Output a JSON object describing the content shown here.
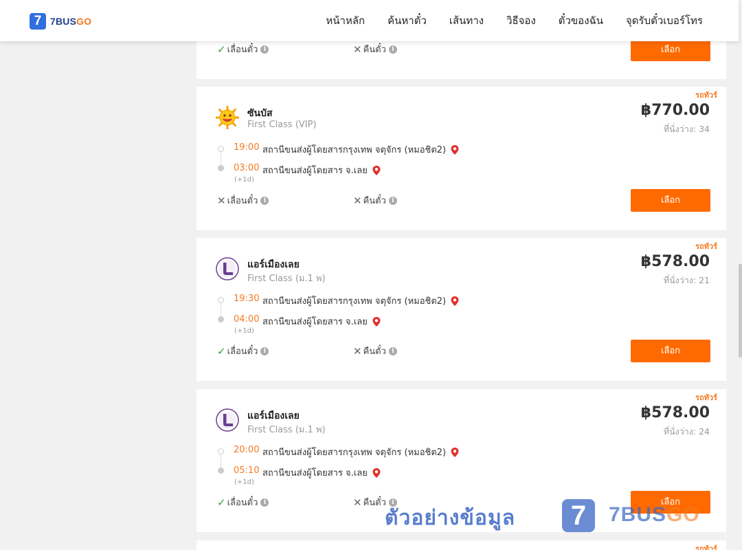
{
  "header": {
    "logo_mark": "7",
    "logo_brand": "7BUS",
    "logo_brand_accent": "GO",
    "nav": [
      "หน้าหลัก",
      "ค้นหาตั๋ว",
      "เส้นทาง",
      "วิธีจอง",
      "ตั๋วของฉัน",
      "จุดรับตั๋วเบอร์โทร"
    ]
  },
  "labels": {
    "reschedule": "เลื่อนตั๋ว",
    "refund": "คืนตั๋ว",
    "select": "เลือก",
    "tag": "รถทัวร์",
    "seats_prefix": "ที่นั่งว่าง: ",
    "info": "i",
    "check_mark": "✓",
    "cross_mark": "✕"
  },
  "partial_card": {
    "reschedule_allowed": true,
    "refund_allowed": false
  },
  "trips": [
    {
      "operator": "ซันบัส",
      "operator_icon": "sun-logo-icon",
      "bus_class": "First Class (VIP)",
      "price": "฿770.00",
      "seats": "ที่นั่งว่าง: 34",
      "depart_time": "19:00",
      "depart_station": "สถานีขนส่งผู้โดยสารกรุงเทพ จตุจักร (หมอชิต2)",
      "arrive_time": "03:00",
      "arrive_station": "สถานีขนส่งผู้โดยสาร จ.เลย",
      "day_offset": "(+1d)",
      "reschedule_allowed": false,
      "refund_allowed": false
    },
    {
      "operator": "แอร์เมืองเลย",
      "operator_icon": "air-muang-loei-logo-icon",
      "bus_class": "First Class (ม.1 พ)",
      "price": "฿578.00",
      "seats": "ที่นั่งว่าง: 21",
      "depart_time": "19:30",
      "depart_station": "สถานีขนส่งผู้โดยสารกรุงเทพ จตุจักร (หมอชิต2)",
      "arrive_time": "04:00",
      "arrive_station": "สถานีขนส่งผู้โดยสาร จ.เลย",
      "day_offset": "(+1d)",
      "reschedule_allowed": true,
      "refund_allowed": false
    },
    {
      "operator": "แอร์เมืองเลย",
      "operator_icon": "air-muang-loei-logo-icon",
      "bus_class": "First Class (ม.1 พ)",
      "price": "฿578.00",
      "seats": "ที่นั่งว่าง: 24",
      "depart_time": "20:00",
      "depart_station": "สถานีขนส่งผู้โดยสารกรุงเทพ จตุจักร (หมอชิต2)",
      "arrive_time": "05:10",
      "arrive_station": "สถานีขนส่งผู้โดยสาร จ.เลย",
      "day_offset": "(+1d)",
      "reschedule_allowed": true,
      "refund_allowed": false
    }
  ],
  "watermark": {
    "text": "ตัวอย่างข้อมูล",
    "logo_mark": "7",
    "brand": "7BUS",
    "brand_accent": "GO"
  },
  "colors": {
    "accent": "#ff6a00",
    "time": "#f47920",
    "pin": "#e0322f",
    "check": "#2e9e3e",
    "brand_blue": "#2f6fe0"
  }
}
